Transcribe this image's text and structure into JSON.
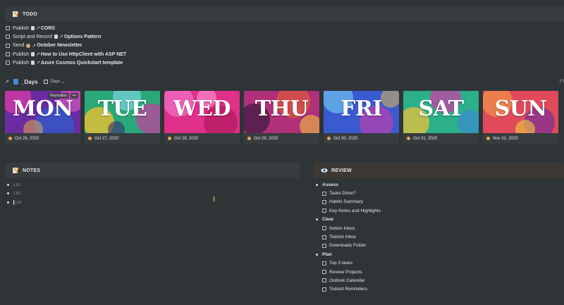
{
  "todo": {
    "title": "TODO",
    "items": [
      {
        "prefix": "Publish",
        "link": "CORS",
        "icon": "page-icon"
      },
      {
        "prefix": "Script and Record",
        "link": "Options Pattern",
        "icon": "page-icon"
      },
      {
        "prefix": "Send",
        "link": "October Newsletter",
        "icon": "ghost-icon"
      },
      {
        "prefix": "Publish",
        "link": "How to Use HttpClient with ASP NET",
        "icon": "page-icon"
      },
      {
        "prefix": "Publish",
        "link": "Azure Cosmos Quickstart template",
        "icon": "page-icon"
      }
    ]
  },
  "days": {
    "title": "_Days",
    "view_label": "Days",
    "filter_label": "Fil",
    "cards": [
      {
        "name": "MON",
        "date": "Oct 26, 2020",
        "hover_label": "Reposition"
      },
      {
        "name": "TUE",
        "date": "Oct 27, 2020"
      },
      {
        "name": "WED",
        "date": "Oct 28, 2020"
      },
      {
        "name": "THU",
        "date": "Oct 29, 2020"
      },
      {
        "name": "FRI",
        "date": "Oct 30, 2020"
      },
      {
        "name": "SAT",
        "date": "Oct 31, 2020"
      },
      {
        "name": "SUN",
        "date": "Nov 01, 2020"
      }
    ]
  },
  "notes": {
    "title": "NOTES",
    "items": [
      "List",
      "List",
      "List"
    ]
  },
  "review": {
    "title": "REVIEW",
    "groups": [
      {
        "label": "Assess",
        "items": [
          "Tasks Done?",
          "Habits Summary",
          "Key Notes and Highlights"
        ]
      },
      {
        "label": "Clear",
        "items": [
          "Notion Inbox",
          "Todoist Inbox",
          "Downloads Folder"
        ]
      },
      {
        "label": "Plan",
        "items": [
          "Top 3 tasks",
          "Review Projects",
          "Outlook Calendar",
          "Todoist Reminders"
        ]
      }
    ]
  },
  "colors": {
    "background": "#2f3437",
    "header": "#373c3f",
    "review_header": "#3c3935",
    "accent_sun": "#f0a44b"
  }
}
